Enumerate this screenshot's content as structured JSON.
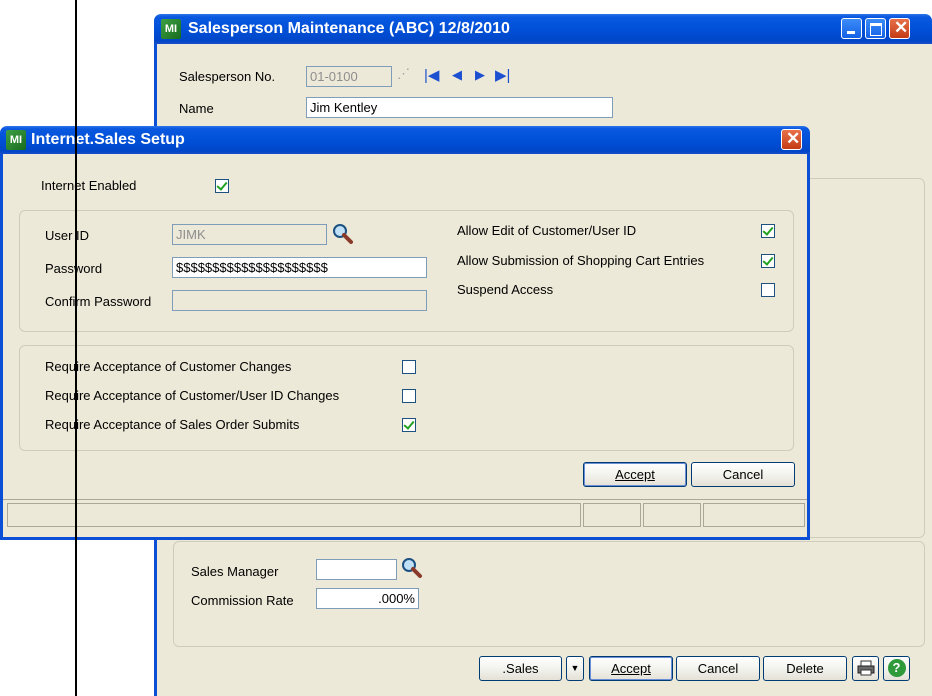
{
  "main_window": {
    "title": "Salesperson Maintenance (ABC) 12/8/2010",
    "icon": "app-icon",
    "salesperson_no_label": "Salesperson No.",
    "salesperson_no_value": "01-0100",
    "name_label": "Name",
    "name_value": "Jim Kentley",
    "sales_manager_label": "Sales Manager",
    "sales_manager_value": "",
    "commission_rate_label": "Commission Rate",
    "commission_rate_value": ".000%",
    "buttons": {
      "sales": ".Sales",
      "accept": "Accept",
      "cancel": "Cancel",
      "delete": "Delete"
    }
  },
  "dialog": {
    "title": "Internet.Sales Setup",
    "icon": "app-icon",
    "internet_enabled_label": "Internet Enabled",
    "internet_enabled": true,
    "user_id_label": "User ID",
    "user_id_value": "JIMK",
    "password_label": "Password",
    "password_value": "$$$$$$$$$$$$$$$$$$$$$",
    "confirm_password_label": "Confirm Password",
    "confirm_password_value": "",
    "allow_edit_label": "Allow Edit of Customer/User ID",
    "allow_edit": true,
    "allow_submission_label": "Allow Submission of Shopping Cart Entries",
    "allow_submission": true,
    "suspend_access_label": "Suspend Access",
    "suspend_access": false,
    "req_customer_changes_label": "Require Acceptance of Customer Changes",
    "req_customer_changes": false,
    "req_userid_changes_label": "Require Acceptance of Customer/User ID Changes",
    "req_userid_changes": false,
    "req_sales_order_label": "Require Acceptance of Sales Order Submits",
    "req_sales_order": true,
    "accept_label": "Accept",
    "cancel_label": "Cancel"
  },
  "colors": {
    "title_bar": "#0050d8",
    "window_face": "#ece9d8",
    "check_mark": "#21a121",
    "close_button": "#c33b14"
  }
}
